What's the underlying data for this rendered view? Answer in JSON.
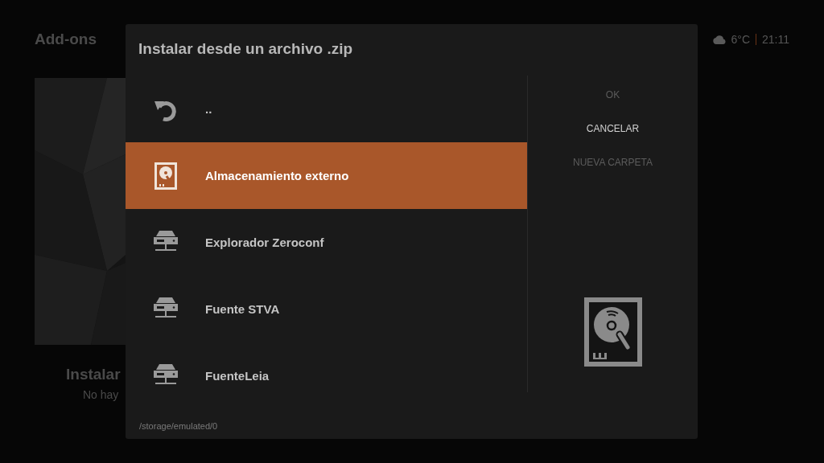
{
  "page": {
    "title": "Add-ons",
    "card": {
      "kind": "picture",
      "title": "Instalar",
      "subtitle": "No hay"
    }
  },
  "status": {
    "temperature": "6°C",
    "time": "21:11"
  },
  "dialog": {
    "title": "Instalar desde un archivo .zip",
    "items": [
      {
        "label": "..",
        "kind": "back",
        "selected": false
      },
      {
        "label": "Almacenamiento externo",
        "kind": "drive",
        "selected": true
      },
      {
        "label": "Explorador Zeroconf",
        "kind": "network",
        "selected": false
      },
      {
        "label": "Fuente STVA",
        "kind": "network",
        "selected": false
      },
      {
        "label": "FuenteLeia",
        "kind": "network",
        "selected": false
      }
    ],
    "buttons": [
      {
        "label": "OK",
        "disabled": true
      },
      {
        "label": "CANCELAR",
        "disabled": false
      },
      {
        "label": "NUEVA CARPETA",
        "disabled": true
      }
    ],
    "path": "/storage/emulated/0"
  }
}
